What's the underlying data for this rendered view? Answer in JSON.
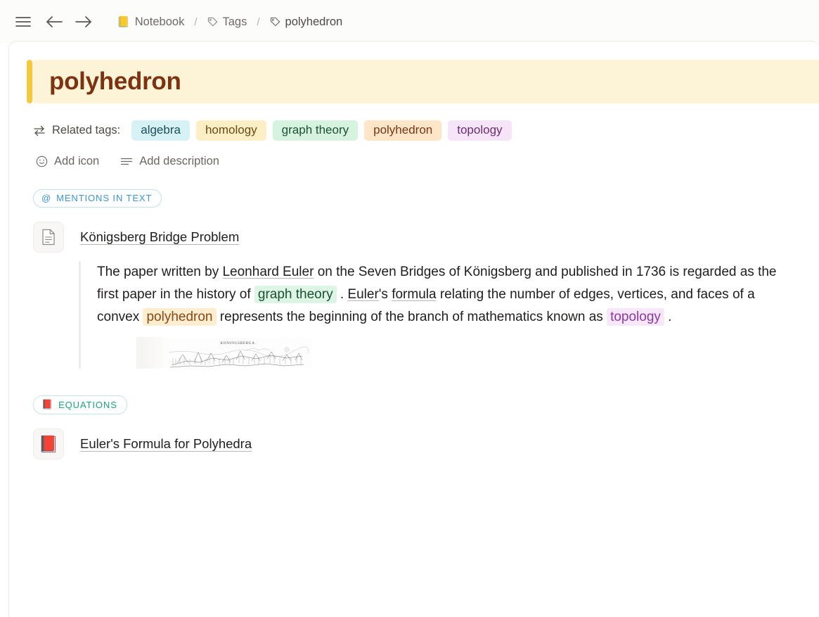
{
  "topbar": {
    "menu_icon": "hamburger-icon",
    "back_icon": "arrow-left-icon",
    "forward_icon": "arrow-right-icon",
    "breadcrumb": [
      {
        "label": "Notebook",
        "icon": "notebook-emoji",
        "glyph": "📒"
      },
      {
        "label": "Tags",
        "icon": "tag-icon",
        "glyph": ""
      },
      {
        "label": "polyhedron",
        "icon": "tag-icon",
        "glyph": ""
      }
    ],
    "separator": "/"
  },
  "page": {
    "title": "polyhedron",
    "title_bg": "#fdf3d7",
    "title_color": "#7d3310",
    "accent_color": "#f5c842"
  },
  "related": {
    "icon": "swap-arrows-icon",
    "label": "Related tags:",
    "tags": [
      {
        "label": "algebra",
        "bg": "#d6f2f5",
        "color": "#1a4f59"
      },
      {
        "label": "homology",
        "bg": "#fcefc6",
        "color": "#6b4a12"
      },
      {
        "label": "graph theory",
        "bg": "#d6f3e0",
        "color": "#1c4f33"
      },
      {
        "label": "polyhedron",
        "bg": "#fde6c8",
        "color": "#7a3416"
      },
      {
        "label": "topology",
        "bg": "#f6e4f8",
        "color": "#6a2b77"
      }
    ]
  },
  "actions": [
    {
      "label": "Add icon",
      "icon": "smiley-face-icon"
    },
    {
      "label": "Add description",
      "icon": "text-lines-icon"
    }
  ],
  "sections": [
    {
      "pill_label": "MENTIONS IN TEXT",
      "pill_icon": "at-sign-icon",
      "pill_glyph": "@",
      "entry_title": "Königsberg Bridge Problem",
      "entry_icon": "document-page-icon"
    },
    {
      "pill_label": "EQUATIONS",
      "pill_icon": "red-book-emoji",
      "pill_glyph": "📕",
      "entry_title": "Euler's Formula for Polyhedra",
      "entry_icon": "red-book-emoji"
    }
  ],
  "excerpt": {
    "t1": "The paper written by ",
    "link1": "Leonhard Euler",
    "t2": " on the Seven Bridges of Königsberg and published in 1736 is regarded as the first paper in the history of ",
    "tag1": "graph theory",
    "t3": " . ",
    "link2": "Euler",
    "t4": "'s ",
    "link3": "formula",
    "t5": " relating the number of edges, vertices, and faces of a convex ",
    "tag2": "polyhedron",
    "t6": " represents the beginning of the branch of mathematics known as ",
    "tag3": "topology",
    "t7": " ."
  },
  "engraving": {
    "caption": "KONINGSBERGA",
    "alt": "historical-engraving-of-konigsberg"
  }
}
